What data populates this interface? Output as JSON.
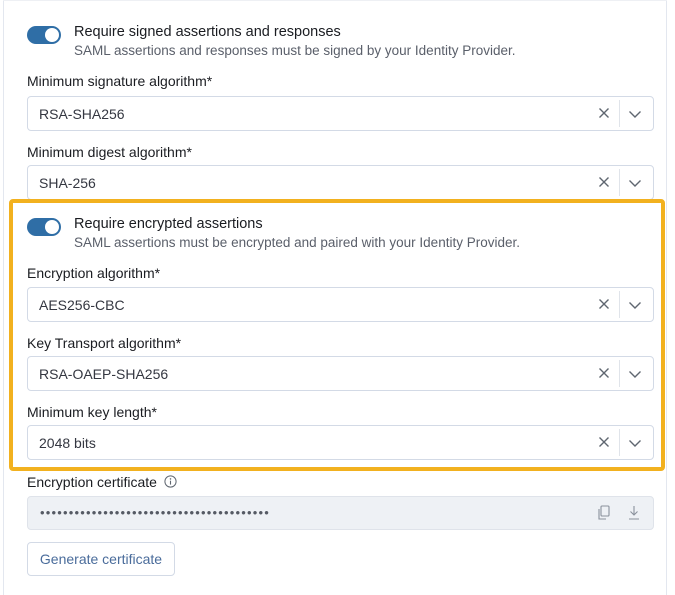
{
  "signed": {
    "title": "Require signed assertions and responses",
    "description": "SAML assertions and responses must be signed by your Identity Provider.",
    "enabled": true
  },
  "signature": {
    "label": "Minimum signature algorithm*",
    "value": "RSA-SHA256"
  },
  "digest": {
    "label": "Minimum digest algorithm*",
    "value": "SHA-256"
  },
  "encrypted": {
    "title": "Require encrypted assertions",
    "description": "SAML assertions must be encrypted and paired with your Identity Provider.",
    "enabled": true
  },
  "encryption_algorithm": {
    "label": "Encryption algorithm*",
    "value": "AES256-CBC"
  },
  "key_transport": {
    "label": "Key Transport algorithm*",
    "value": "RSA-OAEP-SHA256"
  },
  "key_length": {
    "label": "Minimum key length*",
    "value": "2048 bits"
  },
  "certificate": {
    "label": "Encryption certificate",
    "masked_value": "••••••••••••••••••••••••••••••••••••••••"
  },
  "generate_button": "Generate certificate",
  "colors": {
    "toggle_on": "#2f6ea6",
    "highlight": "#f2b11f",
    "button_text": "#4a6c9b"
  },
  "icons": [
    "clear-icon",
    "chevron-down-icon",
    "info-icon",
    "copy-icon",
    "download-icon"
  ]
}
